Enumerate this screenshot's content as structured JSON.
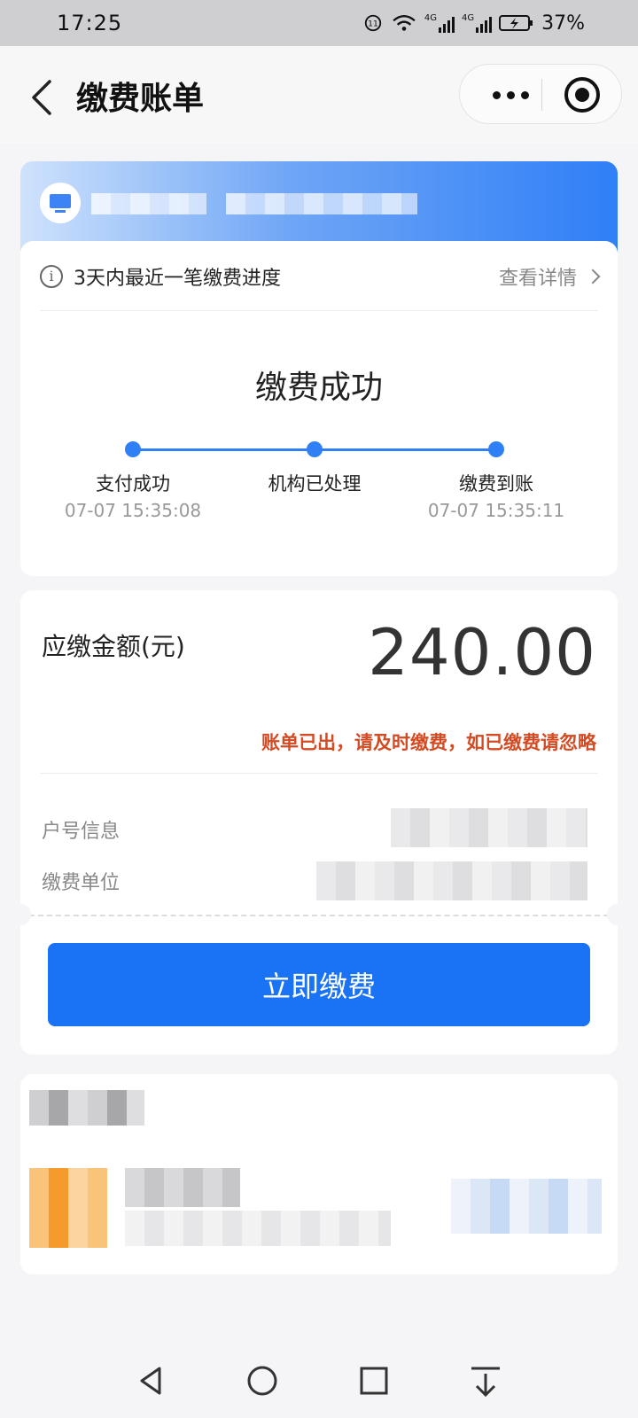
{
  "status_bar": {
    "time": "17:25",
    "battery_percent": "37%",
    "icons": [
      "data-saver-icon",
      "wifi-icon",
      "signal-4g-icon",
      "signal-4g-icon",
      "battery-charging-icon"
    ],
    "signal_label_1": "4G",
    "signal_label_2": "4G"
  },
  "header": {
    "title": "缴费账单",
    "back_icon": "chevron-left-icon",
    "more_icon": "more-dots-icon",
    "close_icon": "target-circle-icon"
  },
  "account_banner": {
    "icon": "tv-icon",
    "accent_color": "#2f7ff7"
  },
  "progress": {
    "notice": "3天内最近一笔缴费进度",
    "detail_link": "查看详情",
    "status": "缴费成功",
    "steps": [
      {
        "label": "支付成功",
        "time": "07-07 15:35:08"
      },
      {
        "label": "机构已处理",
        "time": ""
      },
      {
        "label": "缴费到账",
        "time": "07-07 15:35:11"
      }
    ]
  },
  "bill": {
    "amount_label": "应缴金额(元)",
    "amount": "240.00",
    "warning": "账单已出，请及时缴费，如已缴费请忽略",
    "warning_color": "#d44a22",
    "fields": [
      {
        "label": "户号信息"
      },
      {
        "label": "缴费单位"
      }
    ],
    "pay_button": "立即缴费",
    "pay_button_color": "#1a73f5"
  },
  "system_nav": {
    "icons": [
      "back-triangle-icon",
      "home-circle-icon",
      "recents-square-icon",
      "download-arrow-icon"
    ]
  }
}
